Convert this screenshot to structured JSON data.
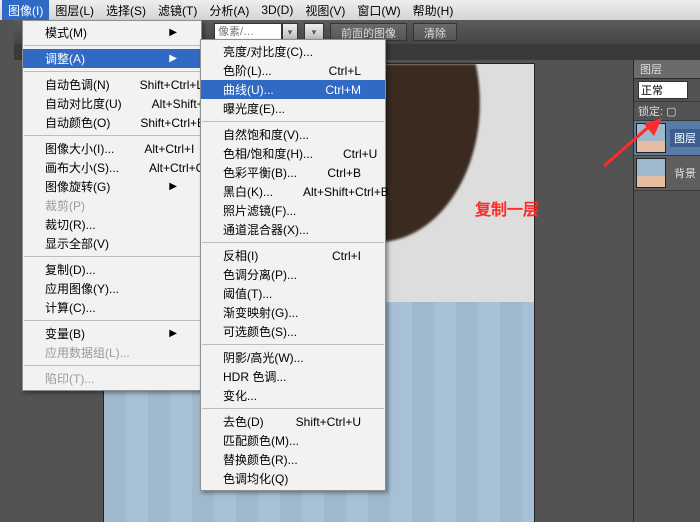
{
  "menubar": {
    "items": [
      {
        "label": "图像(I)",
        "u": "I",
        "selected": true
      },
      {
        "label": "图层(L)",
        "u": "L"
      },
      {
        "label": "选择(S)",
        "u": "S"
      },
      {
        "label": "滤镜(T)",
        "u": "T"
      },
      {
        "label": "分析(A)",
        "u": "A"
      },
      {
        "label": "3D(D)",
        "u": "D"
      },
      {
        "label": "视图(V)",
        "u": "V"
      },
      {
        "label": "窗口(W)",
        "u": "W"
      },
      {
        "label": "帮助(H)",
        "u": "H"
      }
    ]
  },
  "toolbar": {
    "search_placeholder": "像素/…",
    "btn_prev": "前面的图像",
    "btn_clear": "清除"
  },
  "image_menu": [
    {
      "t": "模式(M)",
      "sub": true
    },
    {
      "sep": true
    },
    {
      "t": "调整(A)",
      "sub": true,
      "hl": true
    },
    {
      "sep": true
    },
    {
      "t": "自动色调(N)",
      "k": "Shift+Ctrl+L"
    },
    {
      "t": "自动对比度(U)",
      "k": "Alt+Shift+Ctrl+L"
    },
    {
      "t": "自动颜色(O)",
      "k": "Shift+Ctrl+B"
    },
    {
      "sep": true
    },
    {
      "t": "图像大小(I)...",
      "k": "Alt+Ctrl+I"
    },
    {
      "t": "画布大小(S)...",
      "k": "Alt+Ctrl+C"
    },
    {
      "t": "图像旋转(G)",
      "sub": true
    },
    {
      "t": "裁剪(P)",
      "dis": true
    },
    {
      "t": "裁切(R)..."
    },
    {
      "t": "显示全部(V)"
    },
    {
      "sep": true
    },
    {
      "t": "复制(D)..."
    },
    {
      "t": "应用图像(Y)..."
    },
    {
      "t": "计算(C)..."
    },
    {
      "sep": true
    },
    {
      "t": "变量(B)",
      "sub": true
    },
    {
      "t": "应用数据组(L)...",
      "dis": true
    },
    {
      "sep": true
    },
    {
      "t": "陷印(T)...",
      "dis": true
    }
  ],
  "adjust_menu": [
    {
      "t": "亮度/对比度(C)..."
    },
    {
      "t": "色阶(L)...",
      "k": "Ctrl+L"
    },
    {
      "t": "曲线(U)...",
      "k": "Ctrl+M",
      "hl": true
    },
    {
      "t": "曝光度(E)..."
    },
    {
      "sep": true
    },
    {
      "t": "自然饱和度(V)..."
    },
    {
      "t": "色相/饱和度(H)...",
      "k": "Ctrl+U"
    },
    {
      "t": "色彩平衡(B)...",
      "k": "Ctrl+B"
    },
    {
      "t": "黑白(K)...",
      "k": "Alt+Shift+Ctrl+B"
    },
    {
      "t": "照片滤镜(F)..."
    },
    {
      "t": "通道混合器(X)..."
    },
    {
      "sep": true
    },
    {
      "t": "反相(I)",
      "k": "Ctrl+I"
    },
    {
      "t": "色调分离(P)..."
    },
    {
      "t": "阈值(T)..."
    },
    {
      "t": "渐变映射(G)..."
    },
    {
      "t": "可选颜色(S)..."
    },
    {
      "sep": true
    },
    {
      "t": "阴影/高光(W)..."
    },
    {
      "t": "HDR 色调..."
    },
    {
      "t": "变化..."
    },
    {
      "sep": true
    },
    {
      "t": "去色(D)",
      "k": "Shift+Ctrl+U"
    },
    {
      "t": "匹配颜色(M)..."
    },
    {
      "t": "替换颜色(R)..."
    },
    {
      "t": "色调均化(Q)"
    }
  ],
  "layers": {
    "tab": "图层",
    "mode": "正常",
    "lock": "锁定:",
    "rows": [
      {
        "name": "图层",
        "sel": true
      },
      {
        "name": "背景"
      }
    ]
  },
  "annotation": "复制一层"
}
